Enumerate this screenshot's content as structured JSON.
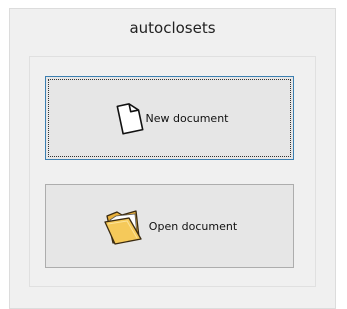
{
  "window": {
    "title": "autoclosets"
  },
  "buttons": {
    "new_document": {
      "label": "New document",
      "icon": "new-document-icon"
    },
    "open_document": {
      "label": "Open document",
      "icon": "folder-open-icon"
    }
  }
}
